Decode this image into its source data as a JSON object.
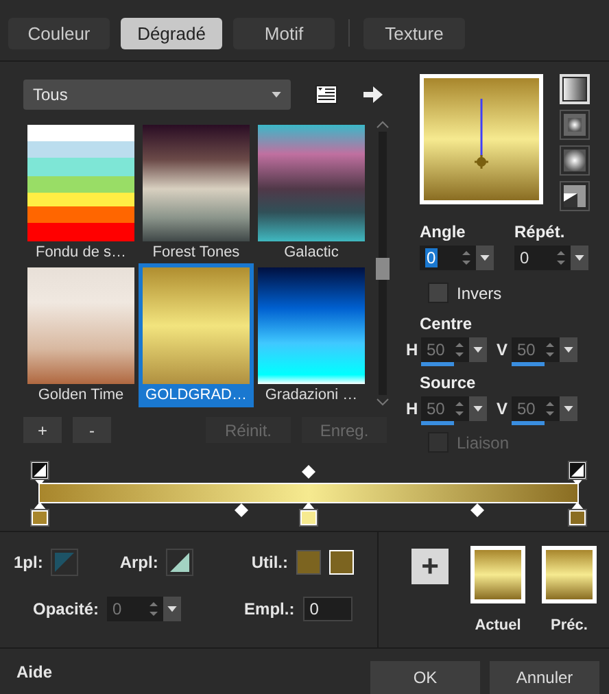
{
  "tabs": [
    {
      "label": "Couleur",
      "selected": false
    },
    {
      "label": "Dégradé",
      "selected": true
    },
    {
      "label": "Motif",
      "selected": false
    },
    {
      "label": "Texture",
      "selected": false
    }
  ],
  "category": {
    "value": "Tous"
  },
  "gradients": [
    {
      "name": "Fondu de s…",
      "selected": false
    },
    {
      "name": "Forest Tones",
      "selected": false
    },
    {
      "name": "Galactic",
      "selected": false
    },
    {
      "name": "Golden Time",
      "selected": false
    },
    {
      "name": "GOLDGRAD…",
      "selected": true
    },
    {
      "name": "Gradazioni …",
      "selected": false
    }
  ],
  "list_buttons": [
    {
      "label": "+",
      "disabled": false
    },
    {
      "label": "-",
      "disabled": false
    },
    {
      "label": "Réinit.",
      "disabled": true
    },
    {
      "label": "Enreg.",
      "disabled": true
    }
  ],
  "styles": [
    {
      "kind": "linear",
      "selected": true
    },
    {
      "kind": "rectangular",
      "selected": false
    },
    {
      "kind": "radial",
      "selected": false
    },
    {
      "kind": "sunburst",
      "selected": false
    }
  ],
  "angle": {
    "label": "Angle",
    "value": "0"
  },
  "repeat": {
    "label": "Répét.",
    "value": "0"
  },
  "invert": {
    "label": "Invers",
    "checked": false,
    "disabled": false
  },
  "centre": {
    "label": "Centre",
    "h": {
      "label": "H",
      "value": "50",
      "level": 0.5,
      "disabled": true
    },
    "v": {
      "label": "V",
      "value": "50",
      "level": 0.5,
      "disabled": true
    }
  },
  "source": {
    "label": "Source",
    "h": {
      "label": "H",
      "value": "50",
      "level": 0.5,
      "disabled": true
    },
    "v": {
      "label": "V",
      "value": "50",
      "level": 0.5,
      "disabled": true
    }
  },
  "link": {
    "label": "Liaison",
    "checked": false,
    "disabled": true
  },
  "opacity_stops": [
    {
      "level": 0
    },
    {
      "level": 1
    }
  ],
  "color_stops": [
    {
      "color": "#a8862c",
      "level": 0
    },
    {
      "color": "#f6ea90",
      "level": 0.5
    },
    {
      "color": "#8a6d22",
      "level": 1
    }
  ],
  "color_midpoints": [
    {
      "level": 0.375
    },
    {
      "level": 0.815
    }
  ],
  "foreground": {
    "label": "1pl:",
    "color": "#1d5366"
  },
  "background": {
    "label": "Arpl:",
    "color": "#a3d3c3"
  },
  "user": {
    "label": "Util.:",
    "swatches": [
      {
        "color": "#7c6420",
        "selected": false
      },
      {
        "color": "#7c6420",
        "selected": true
      }
    ]
  },
  "opacity": {
    "label": "Opacité:",
    "value": "0",
    "disabled": true
  },
  "location": {
    "label": "Empl.:",
    "value": "0"
  },
  "add_button": {
    "label": "+"
  },
  "current": {
    "label": "Actuel"
  },
  "previous": {
    "label": "Préc."
  },
  "help": "Aide",
  "buttons": [
    "OK",
    "Annuler"
  ]
}
